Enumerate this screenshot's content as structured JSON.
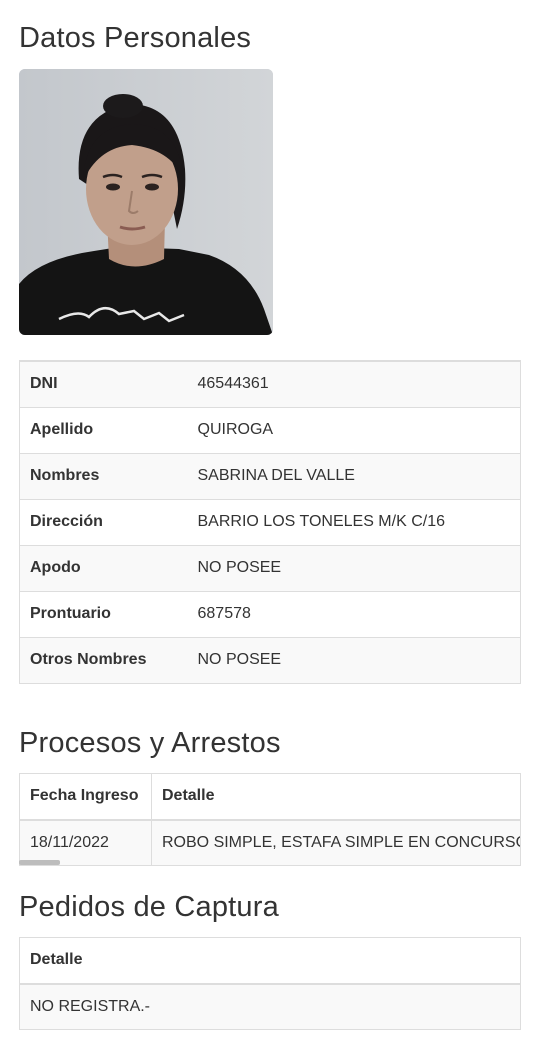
{
  "personal": {
    "title": "Datos Personales",
    "photo": "person-photo",
    "fields": [
      {
        "label": "DNI",
        "value": "46544361"
      },
      {
        "label": "Apellido",
        "value": "QUIROGA"
      },
      {
        "label": "Nombres",
        "value": "SABRINA DEL VALLE"
      },
      {
        "label": "Dirección",
        "value": "BARRIO LOS TONELES M/K C/16"
      },
      {
        "label": "Apodo",
        "value": "NO POSEE"
      },
      {
        "label": "Prontuario",
        "value": "687578"
      },
      {
        "label": "Otros Nombres",
        "value": "NO POSEE"
      }
    ]
  },
  "procesos": {
    "title": "Procesos y Arrestos",
    "headers": {
      "fecha": "Fecha Ingreso",
      "detalle": "Detalle"
    },
    "rows": [
      {
        "fecha": "18/11/2022",
        "detalle": "ROBO SIMPLE, ESTAFA SIMPLE EN CONCURSO REAL"
      }
    ]
  },
  "pedidos": {
    "title": "Pedidos de Captura",
    "headers": {
      "detalle": "Detalle"
    },
    "rows": [
      {
        "detalle": "NO REGISTRA.-"
      }
    ]
  },
  "colors": {
    "border": "#dddddd",
    "stripe": "#f9f9f9",
    "text": "#333333"
  }
}
